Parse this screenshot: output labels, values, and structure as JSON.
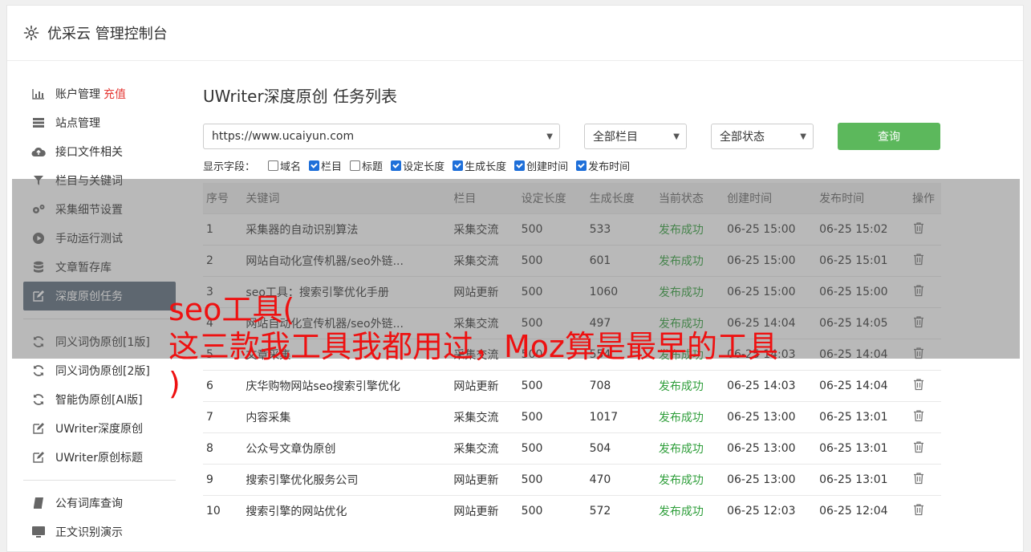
{
  "header": {
    "title": "优采云 管理控制台"
  },
  "sidebar": {
    "group1": [
      {
        "label": "账户管理",
        "extra": "充值",
        "icon": "bar-chart-icon"
      },
      {
        "label": "站点管理",
        "icon": "server-icon"
      },
      {
        "label": "接口文件相关",
        "icon": "cloud-upload-icon"
      },
      {
        "label": "栏目与关键词",
        "icon": "filter-icon"
      },
      {
        "label": "采集细节设置",
        "icon": "gears-icon"
      },
      {
        "label": "手动运行测试",
        "icon": "play-icon"
      },
      {
        "label": "文章暂存库",
        "icon": "database-icon"
      },
      {
        "label": "深度原创任务",
        "icon": "edit-icon"
      }
    ],
    "group2": [
      {
        "label": "同义词伪原创[1版]",
        "icon": "refresh-icon"
      },
      {
        "label": "同义词伪原创[2版]",
        "icon": "refresh-icon"
      },
      {
        "label": "智能伪原创[AI版]",
        "icon": "refresh-icon"
      },
      {
        "label": "UWriter深度原创",
        "icon": "edit-icon"
      },
      {
        "label": "UWriter原创标题",
        "icon": "edit-icon"
      }
    ],
    "group3": [
      {
        "label": "公有词库查询",
        "icon": "book-icon"
      },
      {
        "label": "正文识别演示",
        "icon": "monitor-icon"
      }
    ]
  },
  "main": {
    "title": "UWriter深度原创 任务列表",
    "site_select": "https://www.ucaiyun.com",
    "column_select": "全部栏目",
    "status_select": "全部状态",
    "query_label": "查询",
    "fields_label": "显示字段：",
    "fields": [
      {
        "label": "域名",
        "checked": false
      },
      {
        "label": "栏目",
        "checked": true
      },
      {
        "label": "标题",
        "checked": false
      },
      {
        "label": "设定长度",
        "checked": true
      },
      {
        "label": "生成长度",
        "checked": true
      },
      {
        "label": "创建时间",
        "checked": true
      },
      {
        "label": "发布时间",
        "checked": true
      }
    ]
  },
  "table": {
    "headers": [
      "序号",
      "关键词",
      "栏目",
      "设定长度",
      "生成长度",
      "当前状态",
      "创建时间",
      "发布时间",
      "操作"
    ],
    "rows": [
      [
        "1",
        "采集器的自动识别算法",
        "采集交流",
        "500",
        "533",
        "发布成功",
        "06-25 15:00",
        "06-25 15:02"
      ],
      [
        "2",
        "网站自动化宣传机器/seo外链...",
        "采集交流",
        "500",
        "601",
        "发布成功",
        "06-25 15:00",
        "06-25 15:01"
      ],
      [
        "3",
        "seo工具：搜索引擎优化手册",
        "网站更新",
        "500",
        "1060",
        "发布成功",
        "06-25 15:00",
        "06-25 15:00"
      ],
      [
        "4",
        "网站自动化宣传机器/seo外链...",
        "采集交流",
        "500",
        "497",
        "发布成功",
        "06-25 14:04",
        "06-25 14:05"
      ],
      [
        "5",
        "文章采集",
        "采集交流",
        "500",
        "554",
        "发布成功",
        "06-25 14:03",
        "06-25 14:04"
      ],
      [
        "6",
        "庆华购物网站seo搜索引擎优化",
        "网站更新",
        "500",
        "708",
        "发布成功",
        "06-25 14:03",
        "06-25 14:04"
      ],
      [
        "7",
        "内容采集",
        "采集交流",
        "500",
        "1017",
        "发布成功",
        "06-25 13:00",
        "06-25 13:01"
      ],
      [
        "8",
        "公众号文章伪原创",
        "采集交流",
        "500",
        "504",
        "发布成功",
        "06-25 13:00",
        "06-25 13:01"
      ],
      [
        "9",
        "搜索引擎优化服务公司",
        "网站更新",
        "500",
        "470",
        "发布成功",
        "06-25 13:00",
        "06-25 13:01"
      ],
      [
        "10",
        "搜索引擎的网站优化",
        "网站更新",
        "500",
        "572",
        "发布成功",
        "06-25 12:03",
        "06-25 12:04"
      ]
    ]
  },
  "overlay": {
    "line1": "seo工具(",
    "line2": "这三款我工具我都用过，Moz算是最早的工具",
    "line3": ")"
  },
  "colors": {
    "success": "#2e9e3a",
    "query_button": "#5cb85c",
    "active_nav": "#5a6a7a",
    "recharge": "#e53935",
    "overlay_text": "#ee1111"
  }
}
